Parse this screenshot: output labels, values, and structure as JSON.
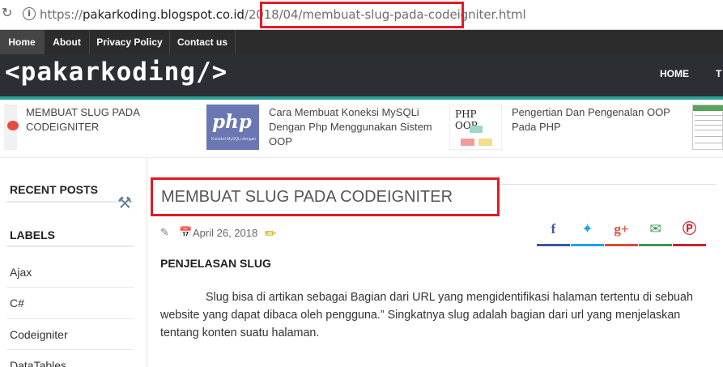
{
  "browser": {
    "url_prefix": "https://",
    "url_host": "pakarkoding.blogspot.co.id",
    "url_path": "/2018/04/",
    "url_slug": "membuat-slug-pada-codeigniter.html"
  },
  "topnav": {
    "items": [
      "Home",
      "About",
      "Privacy Policy",
      "Contact us"
    ]
  },
  "header": {
    "logo": "<pakarkoding/>",
    "mainnav_home": "HOME",
    "mainnav_next": "T"
  },
  "featured": [
    {
      "title": "MEMBUAT SLUG PADA CODEIGNITER"
    },
    {
      "title": "Cara Membuat Koneksi MySQLi Dengan Php Menggunakan Sistem OOP",
      "thumb_text": "php",
      "thumb_sub": "Koneksi MySQLi dengan OOP"
    },
    {
      "title": "Pengertian Dan Pengenalan OOP Pada PHP",
      "thumb_text": "PHP OOP"
    }
  ],
  "sidebar": {
    "recent_posts": "RECENT POSTS",
    "labels_heading": "LABELS",
    "labels": [
      "Ajax",
      "C#",
      "Codeigniter",
      "DataTables"
    ]
  },
  "post": {
    "title": "MEMBUAT SLUG PADA CODEIGNITER",
    "date": "April 26, 2018",
    "section_heading": "PENJELASAN SLUG",
    "paragraph": "Slug bisa di artikan sebagai Bagian dari URL yang mengidentifikasi halaman tertentu di sebuah website yang dapat dibaca oleh pengguna.” Singkatnya slug adalah bagian dari url yang menjelaskan tentang konten suatu halaman."
  },
  "share": {
    "icons": [
      "facebook-icon",
      "twitter-icon",
      "google-plus-icon",
      "email-icon",
      "pinterest-icon"
    ],
    "colors": [
      "#3b5998",
      "#1da1f2",
      "#dd4b39",
      "#3a9b4d",
      "#cb2027"
    ]
  },
  "colors": {
    "highlight": "#e01b24",
    "accent": "#2aa198",
    "header_bg": "#2b2f33",
    "topnav_bg": "#2c2c2c"
  }
}
